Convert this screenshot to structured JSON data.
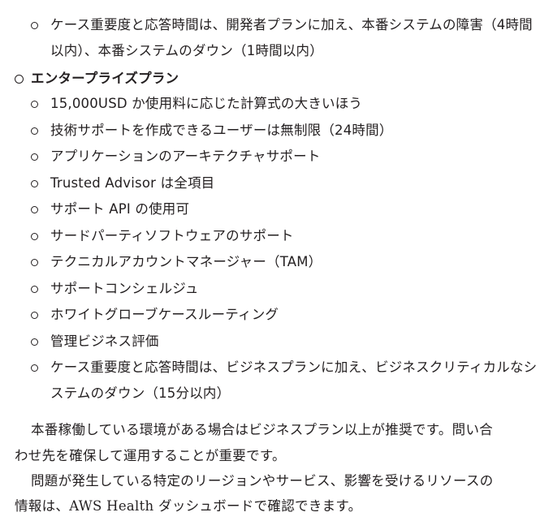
{
  "document": {
    "top_items": [
      "ケース重要度と応答時間は、開発者プランに加え、本番システムの障害（4時間",
      "以内）、本番システムのダウン（1時間以内）"
    ],
    "plan_heading": "エンタープライズプラン",
    "enterprise_items": [
      "15,000USD か使用料に応じた計算式の大きいほう",
      "技術サポートを作成できるユーザーは無制限（24時間）",
      "アプリケーションのアーキテクチャサポート",
      "Trusted Advisor は全項目",
      "サポート API の使用可",
      "サードパーティソフトウェアのサポート",
      "テクニカルアカウントマネージャー（TAM）",
      "サポートコンシェルジュ",
      "ホワイトグローブケースルーティング",
      "管理ビジネス評価"
    ],
    "last_item": [
      "ケース重要度と応答時間は、ビジネスプランに加え、ビジネスクリティカルなシ",
      "ステムのダウン（15分以内）"
    ],
    "paragraphs": [
      "本番稼働している環境がある場合はビジネスプラン以上が推奨です。問い合",
      "わせ先を確保して運用することが重要です。",
      "問題が発生している特定のリージョンやサービス、影響を受けるリソースの",
      "情報は、AWS Health ダッシュボードで確認できます。"
    ]
  }
}
